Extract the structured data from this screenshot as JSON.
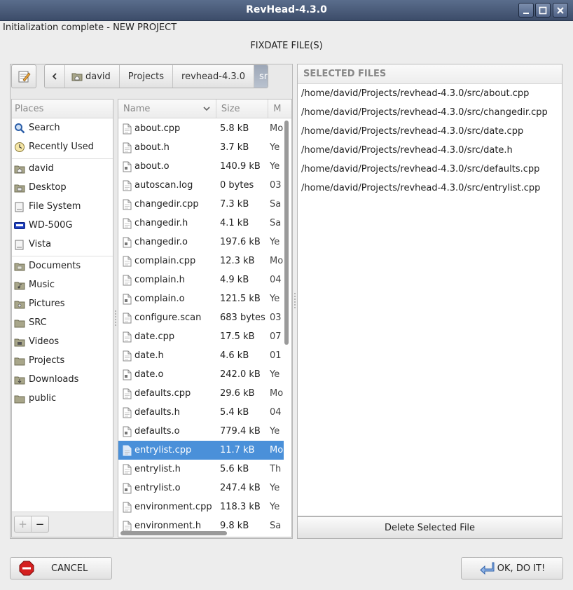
{
  "window": {
    "title": "RevHead-4.3.0"
  },
  "status_text": "Initialization complete - NEW PROJECT",
  "heading": "FIXDATE FILE(S)",
  "path_bar": {
    "crumbs": [
      "david",
      "Projects",
      "revhead-4.3.0",
      "src"
    ]
  },
  "places": {
    "header": "Places",
    "items": [
      {
        "label": "Search",
        "icon": "search-icon"
      },
      {
        "label": "Recently Used",
        "icon": "clock-icon"
      },
      {
        "label": "david",
        "icon": "home-folder-icon"
      },
      {
        "label": "Desktop",
        "icon": "desktop-folder-icon"
      },
      {
        "label": "File System",
        "icon": "drive-icon"
      },
      {
        "label": "WD-500G",
        "icon": "wd-drive-icon"
      },
      {
        "label": "Vista",
        "icon": "drive-icon"
      },
      {
        "label": "Documents",
        "icon": "folder-icon"
      },
      {
        "label": "Music",
        "icon": "music-folder-icon"
      },
      {
        "label": "Pictures",
        "icon": "pictures-folder-icon"
      },
      {
        "label": "SRC",
        "icon": "folder-icon"
      },
      {
        "label": "Videos",
        "icon": "videos-folder-icon"
      },
      {
        "label": "Projects",
        "icon": "folder-icon"
      },
      {
        "label": "Downloads",
        "icon": "downloads-folder-icon"
      },
      {
        "label": "public",
        "icon": "folder-icon"
      }
    ],
    "add_label": "+",
    "remove_label": "−"
  },
  "file_list": {
    "columns": [
      "Name",
      "Size",
      "Modified"
    ],
    "visible_mod_header": "M",
    "rows": [
      {
        "name": "about.cpp",
        "size": "5.8 kB",
        "mod": "Mo",
        "icon": "text-file-icon"
      },
      {
        "name": "about.h",
        "size": "3.7 kB",
        "mod": "Ye",
        "icon": "text-file-icon"
      },
      {
        "name": "about.o",
        "size": "140.9 kB",
        "mod": "Ye",
        "icon": "binary-file-icon"
      },
      {
        "name": "autoscan.log",
        "size": "0 bytes",
        "mod": "03",
        "icon": "text-file-icon"
      },
      {
        "name": "changedir.cpp",
        "size": "7.3 kB",
        "mod": "Sa",
        "icon": "text-file-icon"
      },
      {
        "name": "changedir.h",
        "size": "4.1 kB",
        "mod": "Sa",
        "icon": "text-file-icon"
      },
      {
        "name": "changedir.o",
        "size": "197.6 kB",
        "mod": "Ye",
        "icon": "binary-file-icon"
      },
      {
        "name": "complain.cpp",
        "size": "12.3 kB",
        "mod": "Mo",
        "icon": "text-file-icon"
      },
      {
        "name": "complain.h",
        "size": "4.9 kB",
        "mod": "04",
        "icon": "text-file-icon"
      },
      {
        "name": "complain.o",
        "size": "121.5 kB",
        "mod": "Ye",
        "icon": "binary-file-icon"
      },
      {
        "name": "configure.scan",
        "size": "683 bytes",
        "mod": "03",
        "icon": "text-file-icon"
      },
      {
        "name": "date.cpp",
        "size": "17.5 kB",
        "mod": "07",
        "icon": "text-file-icon"
      },
      {
        "name": "date.h",
        "size": "4.6 kB",
        "mod": "01",
        "icon": "text-file-icon"
      },
      {
        "name": "date.o",
        "size": "242.0 kB",
        "mod": "Ye",
        "icon": "binary-file-icon"
      },
      {
        "name": "defaults.cpp",
        "size": "29.6 kB",
        "mod": "Mo",
        "icon": "text-file-icon"
      },
      {
        "name": "defaults.h",
        "size": "5.4 kB",
        "mod": "04",
        "icon": "text-file-icon"
      },
      {
        "name": "defaults.o",
        "size": "779.4 kB",
        "mod": "Ye",
        "icon": "binary-file-icon"
      },
      {
        "name": "entrylist.cpp",
        "size": "11.7 kB",
        "mod": "Mo",
        "icon": "text-file-icon",
        "selected": true
      },
      {
        "name": "entrylist.h",
        "size": "5.6 kB",
        "mod": "Th",
        "icon": "text-file-icon"
      },
      {
        "name": "entrylist.o",
        "size": "247.4 kB",
        "mod": "Ye",
        "icon": "binary-file-icon"
      },
      {
        "name": "environment.cpp",
        "size": "118.3 kB",
        "mod": "Ye",
        "icon": "text-file-icon"
      },
      {
        "name": "environment.h",
        "size": "9.8 kB",
        "mod": "Sa",
        "icon": "text-file-icon"
      }
    ]
  },
  "selected_files": {
    "header": "SELECTED FILES",
    "items": [
      "/home/david/Projects/revhead-4.3.0/src/about.cpp",
      "/home/david/Projects/revhead-4.3.0/src/changedir.cpp",
      "/home/david/Projects/revhead-4.3.0/src/date.cpp",
      "/home/david/Projects/revhead-4.3.0/src/date.h",
      "/home/david/Projects/revhead-4.3.0/src/defaults.cpp",
      "/home/david/Projects/revhead-4.3.0/src/entrylist.cpp"
    ],
    "delete_label": "Delete Selected File"
  },
  "buttons": {
    "cancel_label": "CANCEL",
    "ok_label": "OK, DO IT!"
  },
  "colors": {
    "selection": "#4a90d9",
    "titlebar": "#3c4c69"
  }
}
